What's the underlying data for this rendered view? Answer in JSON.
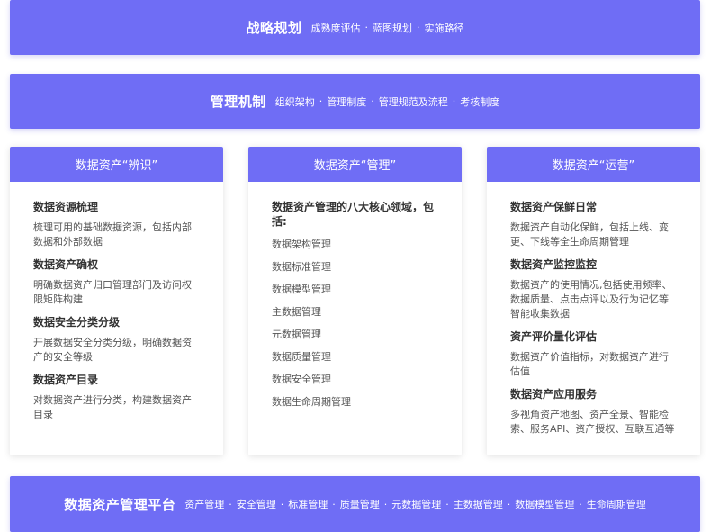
{
  "strategy": {
    "title": "战略规划",
    "items": [
      "成熟度评估",
      "蓝图规划",
      "实施路径"
    ]
  },
  "mechanism": {
    "title": "管理机制",
    "items": [
      "组织架构",
      "管理制度",
      "管理规范及流程",
      "考核制度"
    ]
  },
  "cards": {
    "identify": {
      "header": "数据资产“辨识”",
      "sections": [
        {
          "title": "数据资源梳理",
          "desc": "梳理可用的基础数据资源，包括内部数据和外部数据"
        },
        {
          "title": "数据资产确权",
          "desc": "明确数据资产归口管理部门及访问权限矩阵构建"
        },
        {
          "title": "数据安全分类分级",
          "desc": "开展数据安全分类分级，明确数据资产的安全等级"
        },
        {
          "title": "数据资产目录",
          "desc": "对数据资产进行分类，构建数据资产目录"
        }
      ]
    },
    "manage": {
      "header": "数据资产“管理”",
      "intro": "数据资产管理的八大核心领域，包括:",
      "items": [
        "数据架构管理",
        "数据标准管理",
        "数据模型管理",
        "主数据管理",
        "元数据管理",
        "数据质量管理",
        "数据安全管理",
        "数据生命周期管理"
      ]
    },
    "operate": {
      "header": "数据资产“运营”",
      "sections": [
        {
          "title": "数据资产保鲜日常",
          "desc": "数据资产自动化保鲜，包括上线、变更、下线等全生命周期管理"
        },
        {
          "title": "数据资产监控监控",
          "desc": "数据资产的使用情况,包括使用频率、数据质量、点击点评以及行为记忆等智能收集数据"
        },
        {
          "title": "资产评价量化评估",
          "desc": "数据资产价值指标，对数据资产进行估值"
        },
        {
          "title": "数据资产应用服务",
          "desc": "多视角资产地图、资产全景、智能检索、服务API、资产授权、互联互通等"
        }
      ]
    }
  },
  "platform": {
    "title": "数据资产管理平台",
    "items": [
      "资产管理",
      "安全管理",
      "标准管理",
      "质量管理",
      "元数据管理",
      "主数据管理",
      "数据模型管理",
      "生命周期管理"
    ]
  },
  "separator": "·",
  "colors": {
    "accent": "#6f6df5",
    "card_bg": "#ffffff",
    "text": "#333333"
  }
}
